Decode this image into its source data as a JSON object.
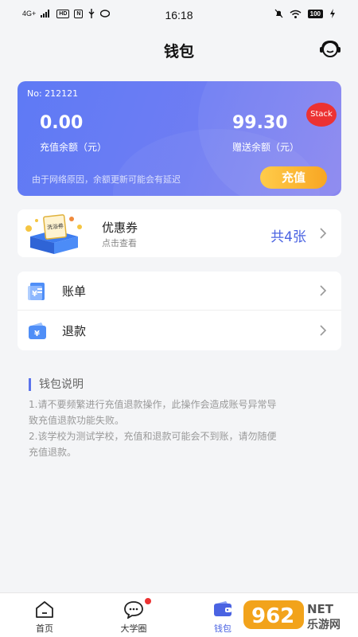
{
  "status_bar": {
    "signal": "4G+",
    "chip1": "HD",
    "chip2": "N",
    "time": "16:18",
    "battery": "100"
  },
  "header": {
    "title": "钱包",
    "service_icon": "customer-service-icon"
  },
  "balance_card": {
    "card_no": "No: 212121",
    "badge": "Stack",
    "recharge_amount": "0.00",
    "recharge_label": "充值余额（元）",
    "gift_amount": "99.30",
    "gift_label": "赠送余额（元）",
    "note": "由于网络原因，余额更新可能会有延迟",
    "recharge_button": "充值",
    "colors": {
      "gradient_start": "#5e7af5",
      "gradient_end": "#8a86f0",
      "button": "#f8a623",
      "badge": "#ec3232"
    }
  },
  "coupon": {
    "title": "优惠券",
    "subtitle": "点击查看",
    "count": "共4张",
    "illustration_text": "洗浴券",
    "accent": "#4a63e2"
  },
  "menu": {
    "items": [
      {
        "label": "账单",
        "icon": "bill-icon"
      },
      {
        "label": "退款",
        "icon": "refund-wallet-icon"
      }
    ]
  },
  "notes": {
    "title": "钱包说明",
    "lines": [
      "1.请不要频繁进行充值退款操作，此操作会造成账号异常导",
      "致充值退款功能失败。",
      "2.该学校为测试学校，充值和退款可能会不到账，请勿随便",
      "充值退款。"
    ]
  },
  "tabbar": {
    "tabs": [
      {
        "label": "首页",
        "icon": "home-icon"
      },
      {
        "label": "大学圈",
        "icon": "chat-bubble-icon"
      },
      {
        "label": "钱包",
        "icon": "wallet-icon"
      }
    ],
    "active": "钱包"
  },
  "watermark": {
    "logo": "962",
    "net": "NET",
    "site": "乐游网"
  }
}
